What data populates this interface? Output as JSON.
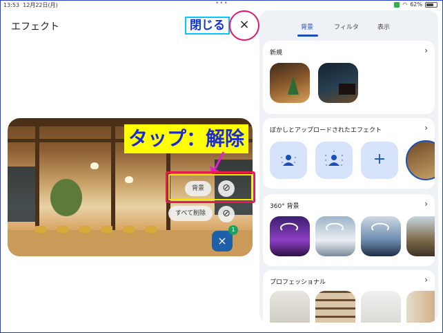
{
  "status_bar": {
    "time": "13:53",
    "date": "12月22日(月)",
    "dots": "•••",
    "battery": "62%"
  },
  "header": {
    "title": "エフェクト",
    "close_annotation": "閉じる",
    "close_icon": "×"
  },
  "annotation": {
    "tap_label": "タップ：解除"
  },
  "preview": {
    "chips": {
      "background": "背景",
      "remove_all": "すべて削除"
    },
    "disable_icon": "⊘",
    "close_icon": "×",
    "badge_count": "1"
  },
  "panel": {
    "tabs": [
      {
        "label": "背景"
      },
      {
        "label": "フィルタ"
      },
      {
        "label": "表示"
      }
    ],
    "sections": [
      {
        "title": "新規",
        "chevron": "›"
      },
      {
        "title": "ぼかしとアップロードされたエフェクト",
        "chevron": "›",
        "add_icon": "+"
      },
      {
        "title": "360° 背景",
        "chevron": "›"
      },
      {
        "title": "プロフェッショナル",
        "chevron": "›"
      }
    ]
  },
  "colors": {
    "accent": "#1a4fbd",
    "highlight_red": "#e81b4c",
    "highlight_yellow": "#ffff00",
    "close_circle": "#e8116b"
  }
}
